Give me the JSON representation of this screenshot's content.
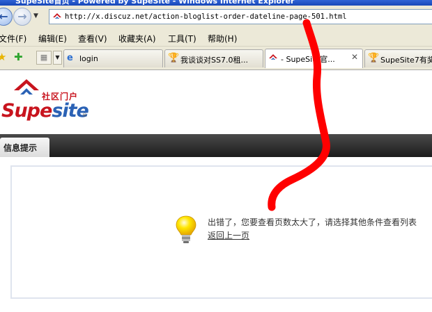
{
  "window": {
    "title": "SupeSite首页 - Powered by SupeSite - Windows Internet Explorer"
  },
  "address": {
    "url": "http://x.discuz.net/action-bloglist-order-dateline-page-501.html"
  },
  "menu": [
    "文件(F)",
    "编辑(E)",
    "查看(V)",
    "收藏夹(A)",
    "工具(T)",
    "帮助(H)"
  ],
  "tabs": [
    {
      "label": "login",
      "icon": "ie-icon"
    },
    {
      "label": "我谈谈对SS7.0租...",
      "icon": "trophy-icon"
    },
    {
      "label": "- SupeSite官...",
      "icon": "supesite-icon",
      "active": true
    },
    {
      "label": "SupeSite7有奖",
      "icon": "trophy-icon"
    }
  ],
  "logo": {
    "community": "社区门户",
    "brand_a": "Supe",
    "brand_b": "site",
    "reg": "®"
  },
  "nav": {
    "active_tab": "信息提示"
  },
  "message": {
    "text": "出错了，您要查看页数太大了，请选择其他条件查看列表",
    "back_link": "返回上一页"
  },
  "colors": {
    "brand_red": "#c8141e",
    "brand_blue": "#2b62b5",
    "scribble": "#ff0000"
  }
}
